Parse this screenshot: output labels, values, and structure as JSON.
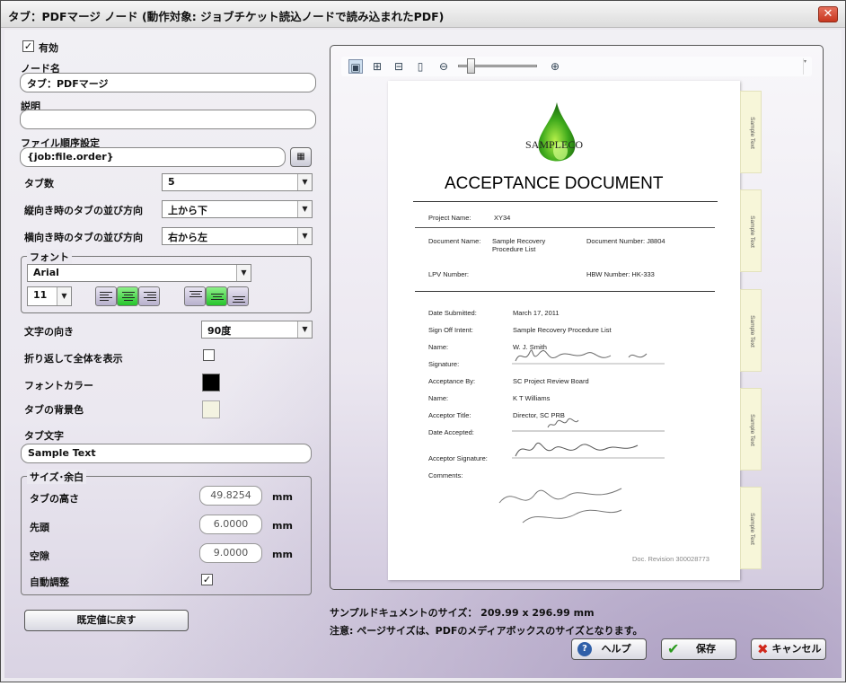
{
  "window": {
    "title": "タブ：PDFマージ ノード (動作対象: ジョブチケット読込ノードで読み込まれたPDF)",
    "close_glyph": "✕"
  },
  "form": {
    "enabled_label": "有効",
    "enabled_check": "✓",
    "node_name_label": "ノード名",
    "node_name_value": "タブ：PDFマージ",
    "description_label": "説明",
    "description_value": "",
    "file_order_label": "ファイル順序設定",
    "file_order_value": "{job:file.order}",
    "tab_count_label": "タブ数",
    "tab_count_value": "5",
    "portrait_dir_label": "縦向き時のタブの並び方向",
    "portrait_dir_value": "上から下",
    "landscape_dir_label": "横向き時のタブの並び方向",
    "landscape_dir_value": "右から左",
    "font_group_label": "フォント",
    "font_name": "Arial",
    "font_size": "11",
    "text_dir_label": "文字の向き",
    "text_dir_value": "90度",
    "wrap_label": "折り返して全体を表示",
    "wrap_check": "",
    "font_color_label": "フォントカラー",
    "font_color": "#000000",
    "tab_bg_label": "タブの背景色",
    "tab_bg_color": "#f5f5dc",
    "tab_text_label": "タブ文字",
    "tab_text_value": "Sample Text",
    "size_group_label": "サイズ･余白",
    "tab_height_label": "タブの高さ",
    "tab_height_value": "49.8254",
    "head_label": "先頭",
    "head_value": "6.0000",
    "gap_label": "空隙",
    "gap_value": "9.0000",
    "unit": "mm",
    "auto_label": "自動調整",
    "auto_check": "✓",
    "reset_button": "既定値に戻す"
  },
  "preview": {
    "toolbar_icons": [
      "image-icon",
      "fit-page-icon",
      "fit-width-icon",
      "single-page-icon",
      "zoom-out-icon",
      "zoom-slider",
      "zoom-in-icon"
    ],
    "doc": {
      "logo": "SAMPLECO",
      "title": "ACCEPTANCE DOCUMENT",
      "project_name_label": "Project Name:",
      "project_name": "XY34",
      "document_name_label": "Document Name:",
      "document_name_1": "Sample Recovery",
      "document_name_2": "Procedure List",
      "document_number": "Document Number: J8804",
      "lpv": "LPV Number:",
      "hbw": "HBW Number: HK-333",
      "date_submitted_label": "Date Submitted:",
      "date_submitted": "March 17, 2011",
      "sign_off_label": "Sign Off Intent:",
      "sign_off": "Sample Recovery Procedure List",
      "name_label": "Name:",
      "name_value": "W. J. Smith",
      "signature_label": "Signature:",
      "acceptance_by_label": "Acceptance By:",
      "acceptance_by": "SC Project Review Board",
      "name2_label": "Name:",
      "name2_value": "K T Williams",
      "acceptor_title_label": "Acceptor Title:",
      "acceptor_title": "Director, SC PRB",
      "date_accepted_label": "Date Accepted:",
      "acceptor_signature_label": "Acceptor Signature:",
      "comments_label": "Comments:",
      "revision": "Doc. Revision 300028773"
    },
    "tab_label": "Sample Text"
  },
  "footer": {
    "size_line": "サンプルドキュメントのサイズ： 209.99 x 296.99 mm",
    "note_line": "注意: ページサイズは、PDFのメディアボックスのサイズとなります。",
    "help_button": "ヘルプ",
    "save_button": "保存",
    "cancel_button": "キャンセル"
  }
}
